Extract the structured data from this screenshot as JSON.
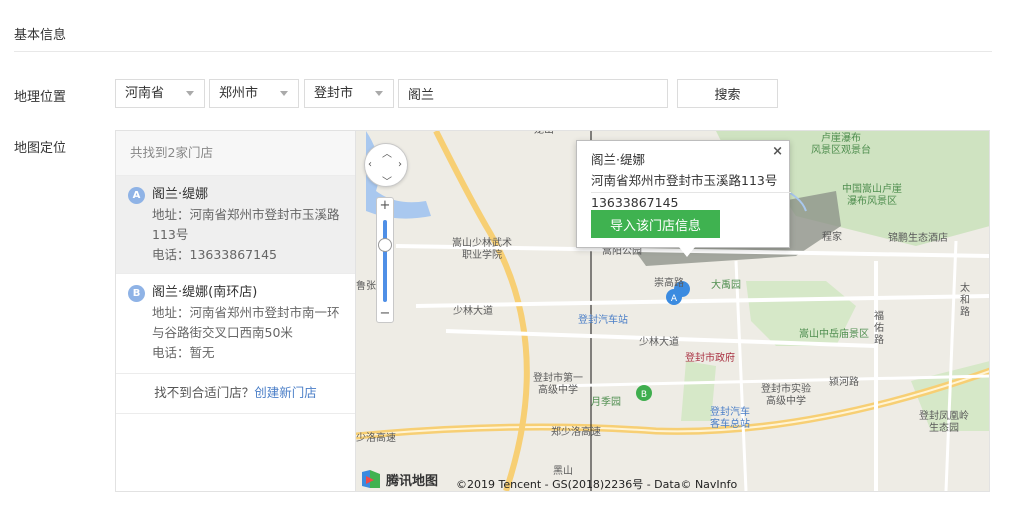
{
  "section": {
    "title": "基本信息"
  },
  "geo": {
    "label": "地理位置",
    "province": "河南省",
    "city": "郑州市",
    "district": "登封市",
    "keyword": "阁兰",
    "search_label": "搜索"
  },
  "map_row": {
    "label": "地图定位"
  },
  "results": {
    "count_text": "共找到2家门店",
    "stores": [
      {
        "badge": "A",
        "name": "阁兰·缇娜",
        "address": "地址：河南省郑州市登封市玉溪路113号",
        "phone": "电话：13633867145"
      },
      {
        "badge": "B",
        "name": "阁兰·缇娜(南环店)",
        "address": "地址：河南省郑州市登封市南一环与谷路街交叉口西南50米",
        "phone": "电话：暂无"
      }
    ],
    "not_found_text": "找不到合适门店？",
    "create_link": "创建新门店"
  },
  "popup": {
    "title": "阁兰·缇娜",
    "address": "河南省郑州市登封市玉溪路113号",
    "phone": "13633867145",
    "import_label": "导入该门店信息",
    "close_glyph": "×"
  },
  "map": {
    "labels": {
      "scenic1": "卢崖瀑布\n风景区观景台",
      "scenic2": "中国嵩山卢崖\n瀑布风景区",
      "college": "嵩山少林武术\n职业学院",
      "park_top": "嵩阳公园",
      "road_songgao": "崇高路",
      "datang": "大禹园",
      "village": "程家",
      "museum": "锦鹏生态酒店",
      "zhuang": "鲁张庄",
      "road_shaolin1": "少林大道",
      "bus": "登封汽车站",
      "road_shaolin2": "少林大道",
      "gov": "登封市政府",
      "zhongyue": "嵩山中岳庙景区",
      "fuyou": "福\n佑\n路",
      "taihe": "太\n和\n路",
      "school1": "登封市第一\n高级中学",
      "yueshou": "月季园",
      "school2": "登封市实验\n高级中学",
      "ying": "颍河路",
      "bus2": "登封汽车\n客车总站",
      "fengtai": "登封凤凰岭\n生态园",
      "highway": "郑少洛高速",
      "highway2": "少洛高速",
      "heishan": "黑山",
      "longshan": "龙山"
    },
    "logo_text": "腾讯地图",
    "copyright": "©2019 Tencent - GS(2018)2236号 - Data© NavInfo",
    "colors": {
      "accent": "#3fb250",
      "link": "#4a7ec7",
      "water": "#a9c8ef",
      "green": "#cfe3c1",
      "road": "#f7cf74"
    }
  }
}
